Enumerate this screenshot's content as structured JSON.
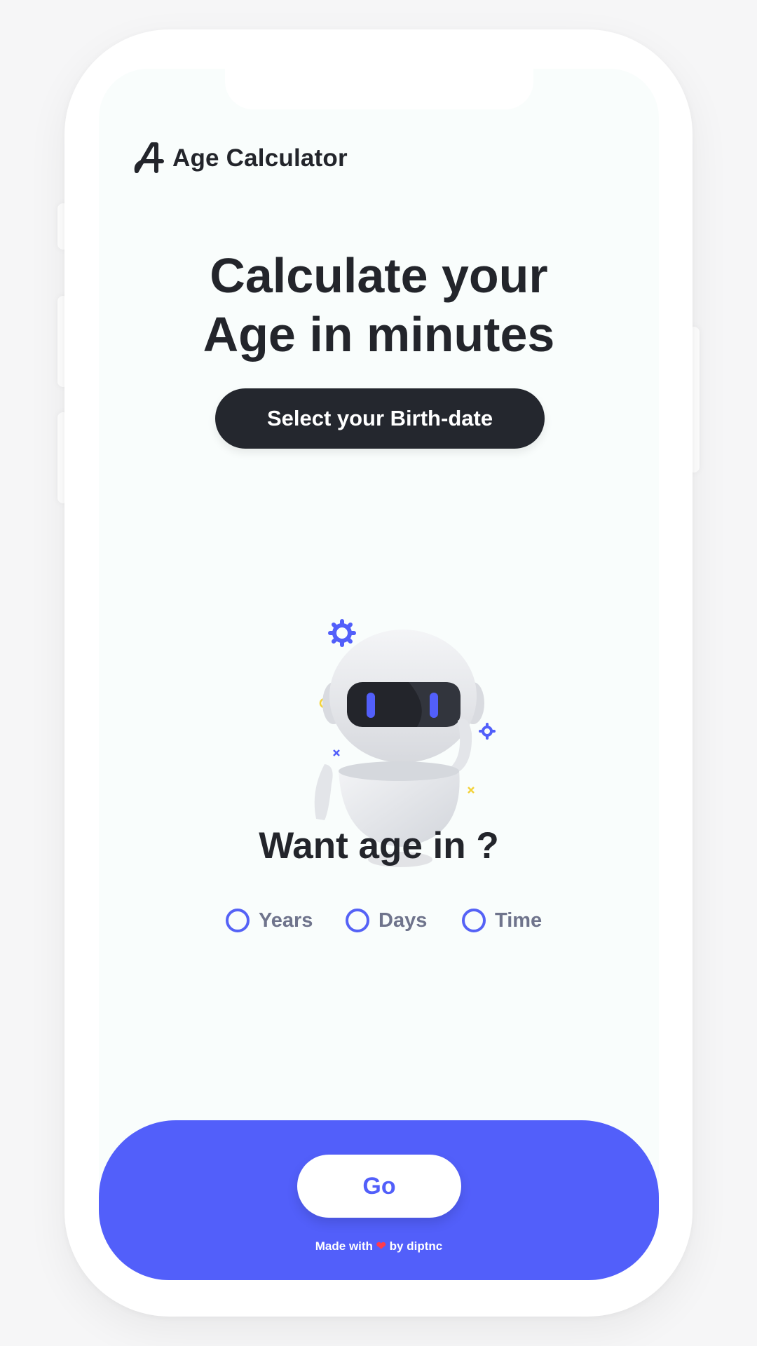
{
  "header": {
    "logo_icon": "age-calculator-logo-icon",
    "title": "Age Calculator"
  },
  "hero": {
    "line1": "Calculate your",
    "line2": "Age in minutes",
    "birthdate_button": "Select your Birth-date"
  },
  "illustration": {
    "icon": "robot-illustration"
  },
  "units": {
    "question": "Want age in ?",
    "options": [
      {
        "label": "Years",
        "selected": false
      },
      {
        "label": "Days",
        "selected": false
      },
      {
        "label": "Time",
        "selected": false
      }
    ]
  },
  "footer": {
    "go_button": "Go",
    "credit_prefix": "Made with",
    "credit_suffix": "by diptnc",
    "heart_icon": "heart-icon"
  },
  "colors": {
    "accent": "#525ffa",
    "dark": "#24272e",
    "screen_bg": "#f9fdfc",
    "option_text": "#6f748c"
  }
}
